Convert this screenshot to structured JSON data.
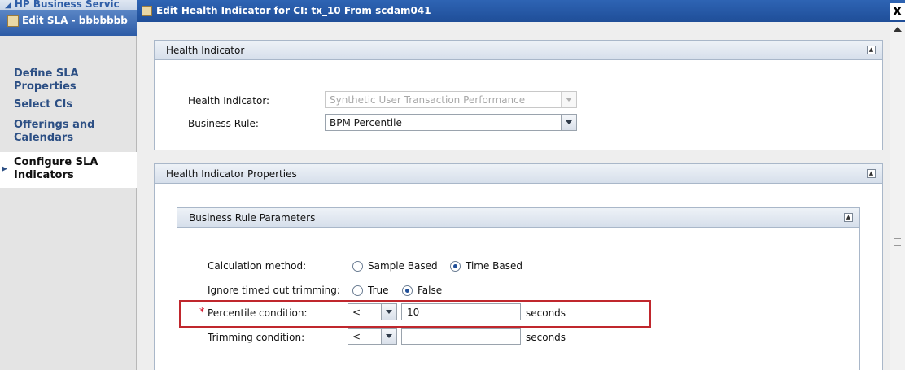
{
  "background_window": {
    "title": "HP Business Servic",
    "sla_title": "Edit SLA - bbbbbbb"
  },
  "wizard_nav": {
    "items": [
      {
        "label": "Define SLA Properties",
        "current": false
      },
      {
        "label": "Select CIs",
        "current": false
      },
      {
        "label": "Offerings and Calendars",
        "current": false
      },
      {
        "label": "Configure SLA Indicators",
        "current": true
      }
    ]
  },
  "dialog": {
    "title": "Edit Health Indicator for CI: tx_10 From scdam041",
    "close_label": "X"
  },
  "health_indicator_panel": {
    "title": "Health Indicator",
    "health_indicator_label": "Health Indicator:",
    "health_indicator_value": "Synthetic User Transaction Performance",
    "business_rule_label": "Business Rule:",
    "business_rule_value": "BPM Percentile"
  },
  "properties_panel": {
    "title": "Health Indicator Properties",
    "business_rule_parameters": {
      "title": "Business Rule Parameters",
      "calculation_method": {
        "label": "Calculation method:",
        "options": [
          "Sample Based",
          "Time Based"
        ],
        "selected": "Time Based"
      },
      "ignore_timed_out": {
        "label": "Ignore timed out trimming:",
        "options": [
          "True",
          "False"
        ],
        "selected": "False"
      },
      "percentile_condition": {
        "required_marker": "*",
        "label": "Percentile condition:",
        "operator": "<",
        "value": "10",
        "unit": "seconds"
      },
      "trimming_condition": {
        "label": "Trimming condition:",
        "operator": "<",
        "value": "",
        "unit": "seconds"
      }
    }
  },
  "colors": {
    "title_bar": "#1f4e98",
    "highlight": "#c0272d",
    "required": "#d0021b",
    "nav_link": "#2c4f84"
  }
}
